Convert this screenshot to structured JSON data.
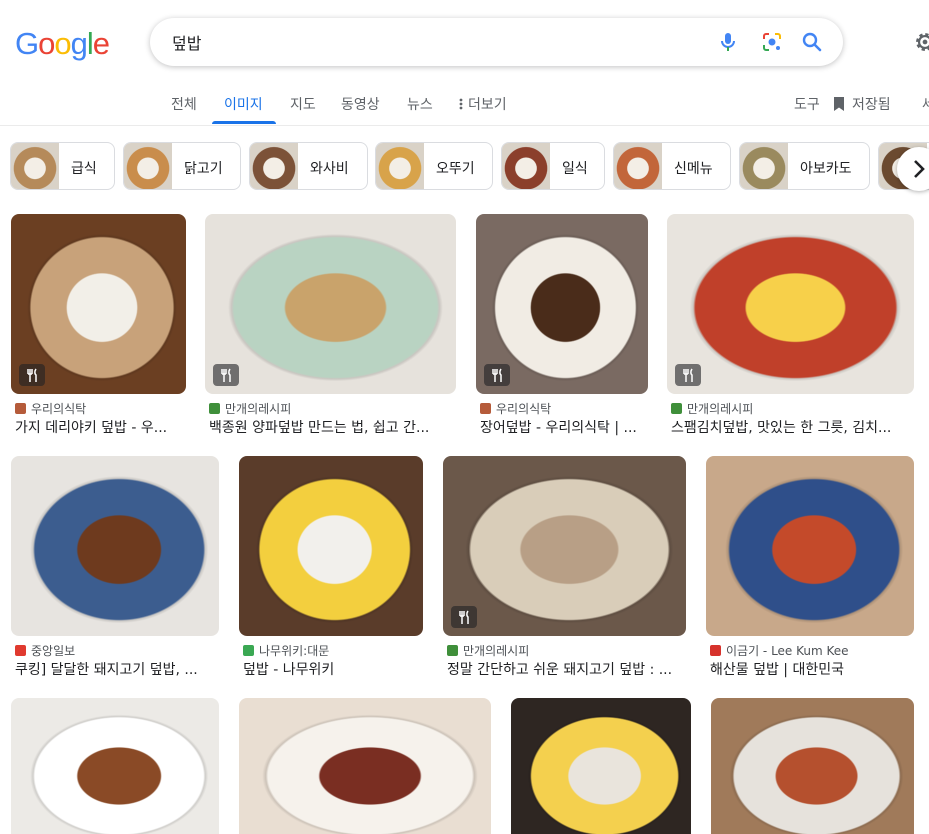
{
  "logo": {
    "letters": [
      "G",
      "o",
      "o",
      "g",
      "l",
      "e"
    ],
    "colors": [
      "#4285f4",
      "#ea4335",
      "#fbbc05",
      "#4285f4",
      "#34a853",
      "#ea4335"
    ]
  },
  "search": {
    "query": "덮밥",
    "icons": [
      "mic-icon",
      "lens-icon",
      "search-icon"
    ]
  },
  "settings": {
    "icon": "gear-icon"
  },
  "tabs": [
    {
      "label": "전체"
    },
    {
      "label": "이미지",
      "active": true
    },
    {
      "label": "지도"
    },
    {
      "label": "동영상"
    },
    {
      "label": "뉴스"
    },
    {
      "label": "더보기",
      "icon": "more-vert-icon"
    }
  ],
  "tools": {
    "tools_label": "도구",
    "saved_label": "저장됨",
    "saved_icon": "bookmark-icon",
    "safe_partial": "세"
  },
  "chips": [
    {
      "label": "급식",
      "color": "#b58a5a"
    },
    {
      "label": "닭고기",
      "color": "#c98d4c"
    },
    {
      "label": "와사비",
      "color": "#7c5238"
    },
    {
      "label": "오뚜기",
      "color": "#d8a34a"
    },
    {
      "label": "일식",
      "color": "#8b3f2b"
    },
    {
      "label": "신메뉴",
      "color": "#c2663a"
    },
    {
      "label": "아보카도",
      "color": "#9a8a5e"
    },
    {
      "label": "",
      "color": "#6b4a30"
    }
  ],
  "results": [
    {
      "source": "우리의식탁",
      "title": "가지 데리야키 덮밥 - 우...",
      "fav": "#b55b3a",
      "colors": [
        "#6b3f22",
        "#c8a27a",
        "#f2efe8"
      ],
      "badge": true
    },
    {
      "source": "만개의레시피",
      "title": "백종원 양파덮밥 만드는 법, 쉽고 간...",
      "fav": "#3f8f3a",
      "colors": [
        "#e6e2dc",
        "#b9d3c2",
        "#c9a36b"
      ],
      "badge": true
    },
    {
      "source": "우리의식탁",
      "title": "장어덮밥 - 우리의식탁 | ...",
      "fav": "#b55b3a",
      "colors": [
        "#7a6a62",
        "#f1ece4",
        "#4a2c1a"
      ],
      "badge": true
    },
    {
      "source": "만개의레시피",
      "title": "스팸김치덮밥, 맛있는 한 그릇, 김치...",
      "fav": "#3f8f3a",
      "colors": [
        "#e8e4de",
        "#c0402a",
        "#f7d04a"
      ],
      "badge": true
    },
    {
      "source": "중앙일보",
      "title": "쿠킹] 달달한 돼지고기 덮밥, ...",
      "fav": "#e03a2f",
      "colors": [
        "#e7e4e0",
        "#3c5d8f",
        "#6e3a1e"
      ],
      "badge": false
    },
    {
      "source": "나무위키:대문",
      "title": "덮밥 - 나무위키",
      "fav": "#3aa853",
      "colors": [
        "#5a3c2a",
        "#f3cf3e",
        "#f2f0ec"
      ],
      "badge": false
    },
    {
      "source": "만개의레시피",
      "title": "정말 간단하고 쉬운 돼지고기 덮밥 : ...",
      "fav": "#3f8f3a",
      "colors": [
        "#6b584a",
        "#d9cdb9",
        "#b89f86"
      ],
      "badge": true
    },
    {
      "source": "이금기 - Lee Kum Kee",
      "title": "해산물 덮밥 | 대한민국",
      "fav": "#d6322c",
      "colors": [
        "#c8a88a",
        "#2f4f8a",
        "#c44a2a"
      ],
      "badge": false
    },
    {
      "source": "",
      "title": "",
      "fav": "",
      "colors": [
        "#eceae6",
        "#ffffff",
        "#8a4a26"
      ],
      "badge": false
    },
    {
      "source": "",
      "title": "",
      "fav": "",
      "colors": [
        "#e9ded2",
        "#f6f2ec",
        "#7a2e22"
      ],
      "badge": false
    },
    {
      "source": "",
      "title": "",
      "fav": "",
      "colors": [
        "#2e2622",
        "#f4d04e",
        "#e9e4dc"
      ],
      "badge": false
    },
    {
      "source": "",
      "title": "",
      "fav": "",
      "colors": [
        "#a07a5a",
        "#e6e2dc",
        "#b5502e"
      ],
      "badge": false
    }
  ]
}
